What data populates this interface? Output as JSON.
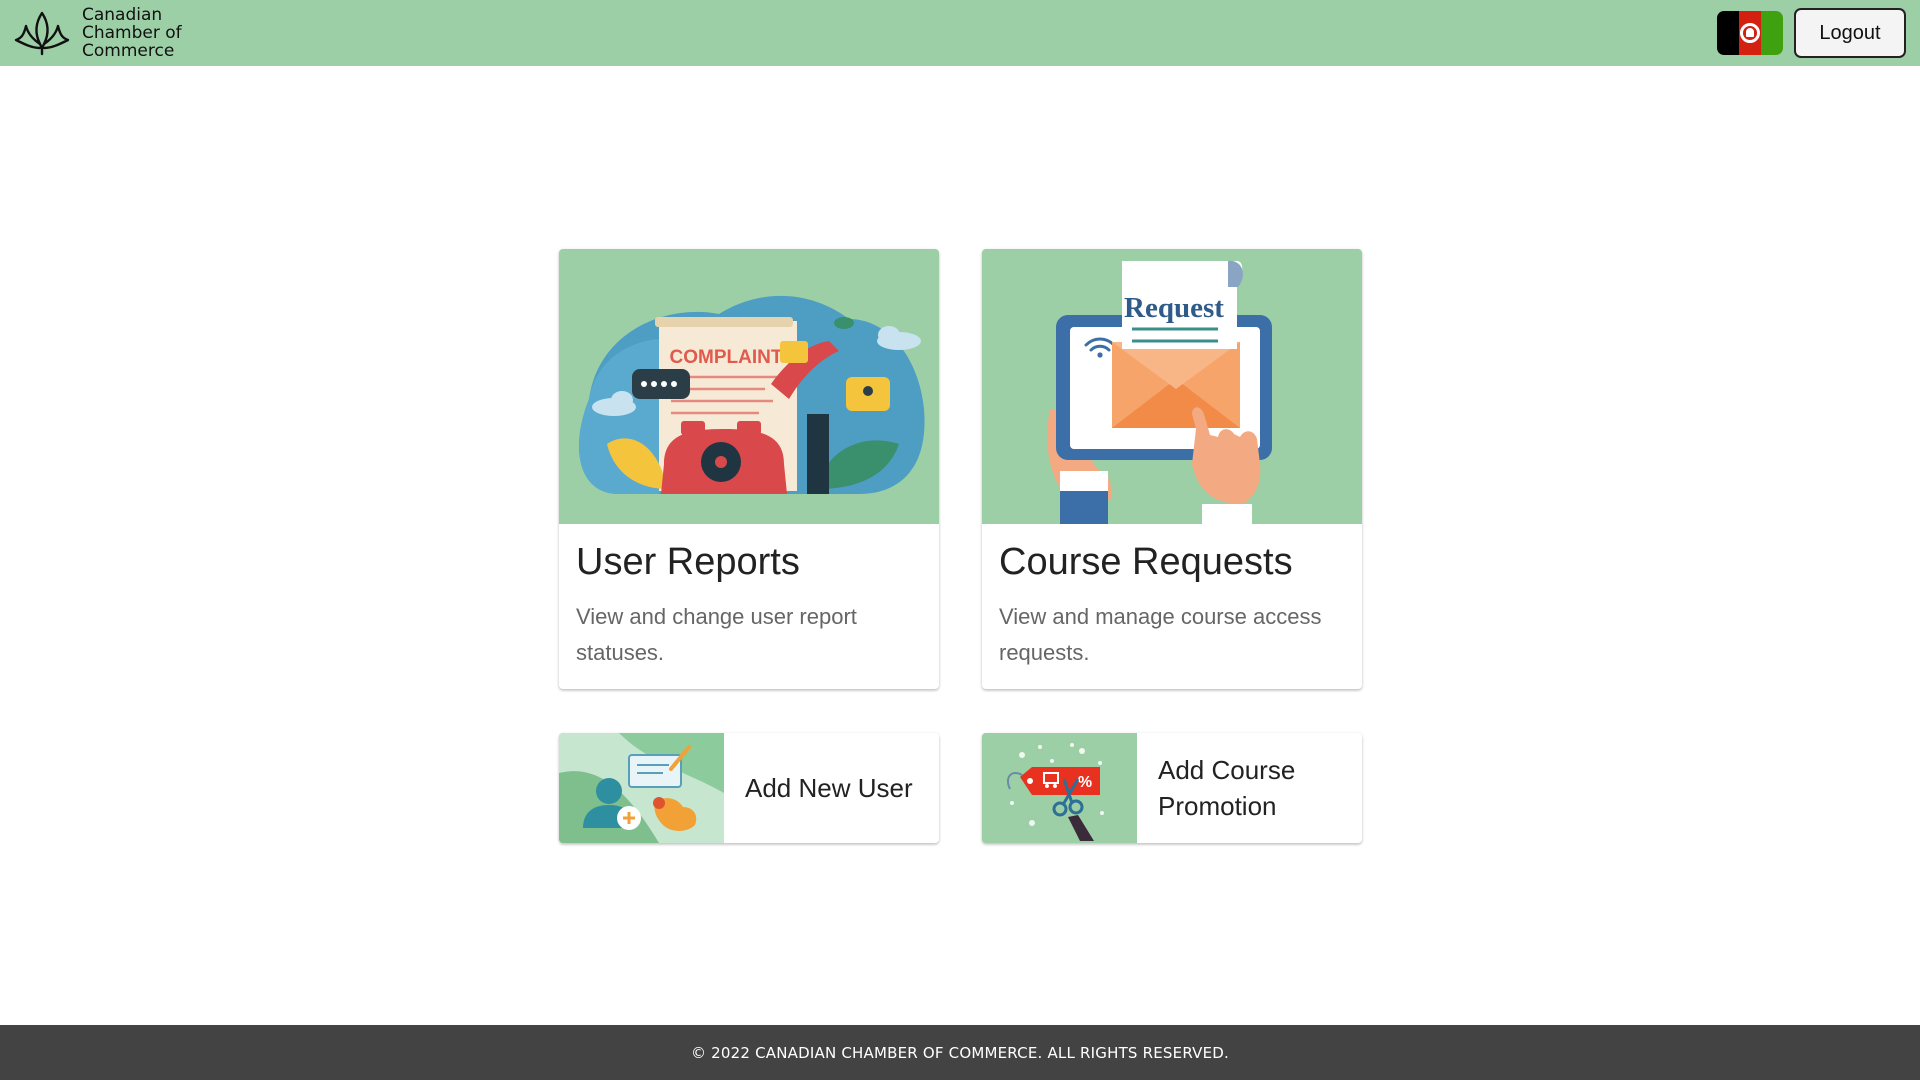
{
  "header": {
    "logo_lines": [
      "Canadian",
      "Chamber of",
      "Commerce"
    ],
    "logout_label": "Logout",
    "language_flag": "afghanistan-flag-icon",
    "background_color": "#9dcfa7"
  },
  "cards": [
    {
      "title": "User Reports",
      "description": "View and change user report statuses.",
      "illustration": "complaint-illustration-icon",
      "illustration_text": "COMPLAINT"
    },
    {
      "title": "Course Requests",
      "description": "View and manage course access requests.",
      "illustration": "request-tablet-illustration-icon",
      "illustration_text": "Request"
    }
  ],
  "actions": [
    {
      "label": "Add New User",
      "icon": "add-user-illustration-icon"
    },
    {
      "label": "Add Course Promotion",
      "icon": "promotion-tag-illustration-icon"
    }
  ],
  "footer": {
    "copyright": "© 2022 CANADIAN CHAMBER OF COMMERCE. ALL RIGHTS RESERVED.",
    "background_color": "#434343"
  }
}
